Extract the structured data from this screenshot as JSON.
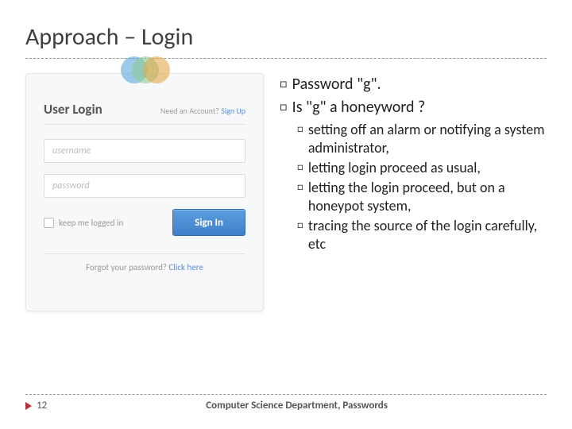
{
  "title": "Approach – Login",
  "panel": {
    "title": "User Login",
    "signup_prefix": "Need an Account?",
    "signup_link": "Sign Up",
    "username_placeholder": "username",
    "password_placeholder": "password",
    "keep_logged": "keep me logged in",
    "signin": "Sign In",
    "forgot_prefix": "Forgot your password?",
    "forgot_link": "Click here"
  },
  "bullets": {
    "top": [
      "Password \"g\".",
      "Is \"g\" a honeyword ?"
    ],
    "sub": [
      "setting off an alarm or notifying a system administrator,",
      " letting login proceed as usual,",
      " letting the login proceed, but on a honeypot system,",
      " tracing the source of the login carefully, etc"
    ]
  },
  "footer": {
    "page": "12",
    "text": "Computer Science Department, Passwords"
  }
}
